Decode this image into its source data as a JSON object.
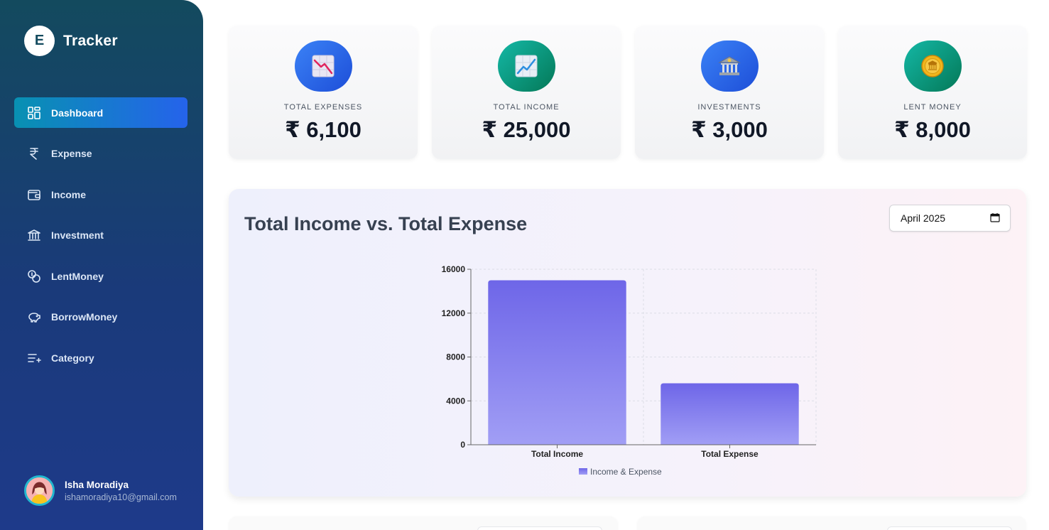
{
  "brand": {
    "logo_letter": "E",
    "name": "Tracker"
  },
  "nav": [
    {
      "label": "Dashboard",
      "icon": "dashboard-icon",
      "active": true
    },
    {
      "label": "Expense",
      "icon": "rupee-icon"
    },
    {
      "label": "Income",
      "icon": "wallet-icon"
    },
    {
      "label": "Investment",
      "icon": "bank-icon"
    },
    {
      "label": "LentMoney",
      "icon": "coins-icon"
    },
    {
      "label": "BorrowMoney",
      "icon": "piggy-bank-icon"
    },
    {
      "label": "Category",
      "icon": "list-add-icon"
    }
  ],
  "user": {
    "name": "Isha Moradiya",
    "email": "ishamoradiya10@gmail.com"
  },
  "stats": [
    {
      "label": "TOTAL EXPENSES",
      "value": "₹ 6,100",
      "icon": "chart-down-icon",
      "color": "#2563eb"
    },
    {
      "label": "TOTAL INCOME",
      "value": "₹ 25,000",
      "icon": "chart-up-icon",
      "color": "#0f9f86"
    },
    {
      "label": "INVESTMENTS",
      "value": "₹ 3,000",
      "icon": "bank-icon",
      "color": "#2563eb"
    },
    {
      "label": "LENT MONEY",
      "value": "₹ 8,000",
      "icon": "coin-icon",
      "color": "#0f9f86"
    }
  ],
  "panel": {
    "title": "Total Income vs. Total Expense",
    "month_value": "April 2025"
  },
  "chart_data": {
    "type": "bar",
    "categories": [
      "Total Income",
      "Total Expense"
    ],
    "series": [
      {
        "name": "Income & Expense",
        "values": [
          15000,
          5600
        ]
      }
    ],
    "ylim": [
      0,
      16000
    ],
    "yticks": [
      "16000",
      "12000",
      "8000",
      "4000",
      "0"
    ],
    "grid": true,
    "legend": "bottom",
    "bar_color_top": "#6e66e8",
    "bar_color_bottom": "#a19ef5"
  }
}
